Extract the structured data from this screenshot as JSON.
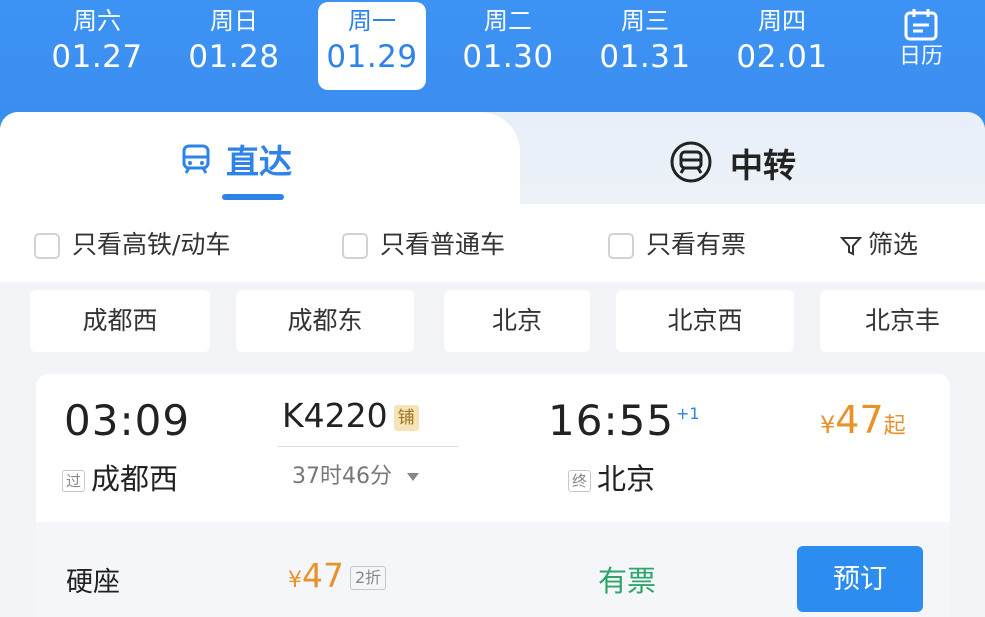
{
  "dates": [
    {
      "weekday": "周六",
      "date": "01.27"
    },
    {
      "weekday": "周日",
      "date": "01.28"
    },
    {
      "weekday": "周一",
      "date": "01.29"
    },
    {
      "weekday": "周二",
      "date": "01.30"
    },
    {
      "weekday": "周三",
      "date": "01.31"
    },
    {
      "weekday": "周四",
      "date": "02.01"
    }
  ],
  "calendar_label": "日历",
  "tabs": {
    "direct": "直达",
    "transfer": "中转"
  },
  "filters": {
    "high_speed": "只看高铁/动车",
    "normal": "只看普通车",
    "available": "只看有票",
    "filter": "筛选"
  },
  "stations": [
    "成都西",
    "成都东",
    "北京",
    "北京西",
    "北京丰"
  ],
  "train": {
    "depart_time": "03:09",
    "depart_badge": "过",
    "depart_station": "成都西",
    "number": "K4220",
    "bed_badge": "铺",
    "duration": "37时46分",
    "arrive_time": "16:55",
    "arrive_plus": "+1",
    "arrive_badge": "终",
    "arrive_station": "北京",
    "currency": "¥",
    "price": "47",
    "price_suffix": "起"
  },
  "seat": {
    "type": "硬座",
    "currency": "¥",
    "price": "47",
    "discount": "2折",
    "availability": "有票",
    "book_label": "预订"
  },
  "colors": {
    "primary": "#2d83e8",
    "price": "#e8922a",
    "available": "#2fa56a"
  }
}
